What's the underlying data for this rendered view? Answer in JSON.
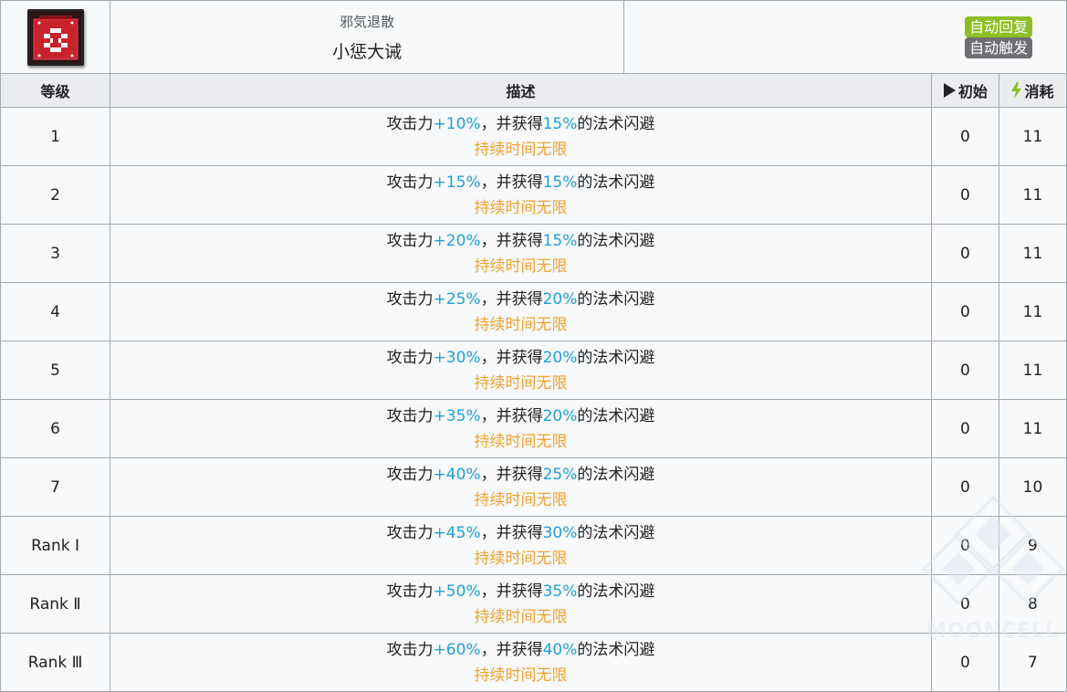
{
  "skill": {
    "icon": "ornamental-emblem-icon",
    "subtitle": "邪気退散",
    "name": "小惩大诫",
    "tags": [
      "自动回复",
      "自动触发"
    ],
    "tag_colors": [
      "#8bbf23",
      "#6d6f72"
    ]
  },
  "columns": {
    "level": "等级",
    "description": "描述",
    "initial": "初始",
    "cost": "消耗",
    "initial_icon": "play-triangle-icon",
    "cost_icon": "lightning-icon"
  },
  "text": {
    "atk_prefix": "攻击力",
    "middle": "，并获得",
    "suffix": "的法术闪避",
    "duration": "持续时间无限"
  },
  "rows": [
    {
      "level": "1",
      "atk": "+10%",
      "dodge": "15%",
      "initial": "0",
      "cost": "11"
    },
    {
      "level": "2",
      "atk": "+15%",
      "dodge": "15%",
      "initial": "0",
      "cost": "11"
    },
    {
      "level": "3",
      "atk": "+20%",
      "dodge": "15%",
      "initial": "0",
      "cost": "11"
    },
    {
      "level": "4",
      "atk": "+25%",
      "dodge": "20%",
      "initial": "0",
      "cost": "11"
    },
    {
      "level": "5",
      "atk": "+30%",
      "dodge": "20%",
      "initial": "0",
      "cost": "11"
    },
    {
      "level": "6",
      "atk": "+35%",
      "dodge": "20%",
      "initial": "0",
      "cost": "11"
    },
    {
      "level": "7",
      "atk": "+40%",
      "dodge": "25%",
      "initial": "0",
      "cost": "10"
    },
    {
      "level": "Rank Ⅰ",
      "atk": "+45%",
      "dodge": "30%",
      "initial": "0",
      "cost": "9"
    },
    {
      "level": "Rank Ⅱ",
      "atk": "+50%",
      "dodge": "35%",
      "initial": "0",
      "cost": "8"
    },
    {
      "level": "Rank Ⅲ",
      "atk": "+60%",
      "dodge": "40%",
      "initial": "0",
      "cost": "7"
    }
  ],
  "watermark": "MOONCELL",
  "accent_colors": {
    "highlight": "#1ea0d8",
    "duration": "#f0a230",
    "cost_icon": "#8bbf23"
  }
}
